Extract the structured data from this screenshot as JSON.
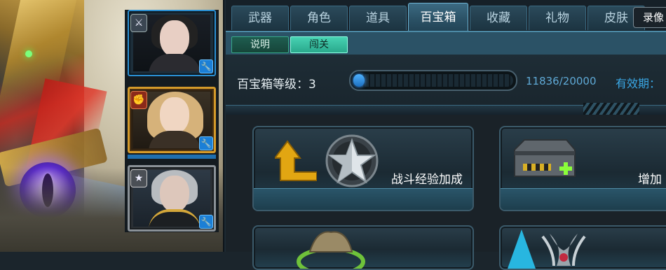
{
  "tabs": [
    {
      "label": "武器"
    },
    {
      "label": "角色"
    },
    {
      "label": "道具"
    },
    {
      "label": "百宝箱",
      "active": true
    },
    {
      "label": "收藏"
    },
    {
      "label": "礼物"
    },
    {
      "label": "皮肤"
    }
  ],
  "record_button": "录像",
  "subtabs": [
    {
      "label": "说明"
    },
    {
      "label": "闯关",
      "active": true
    }
  ],
  "treasure": {
    "level_label": "百宝箱等级：3",
    "exp_text": "11836/20000",
    "exp_current": 11836,
    "exp_max": 20000,
    "valid_label": "有效期：",
    "progress_fraction": 0.07
  },
  "cards": [
    {
      "label": "战斗经验加成",
      "icon": "xp-boost-star-icon"
    },
    {
      "label": "增加",
      "icon": "chest-plus-icon"
    },
    {
      "label": "",
      "icon": "supply-sack-icon"
    },
    {
      "label": "",
      "icon": "wings-emblem-icon"
    }
  ],
  "characters": [
    {
      "icon": "sword-emblem-icon",
      "state": "selected"
    },
    {
      "icon": "fist-emblem-icon",
      "state": "gold"
    },
    {
      "icon": "star-emblem-icon",
      "state": "silver"
    }
  ],
  "colors": {
    "accent_blue": "#3aa8e6",
    "active_subtab": "#47d3b3",
    "gold_frame": "#d49a2a"
  }
}
